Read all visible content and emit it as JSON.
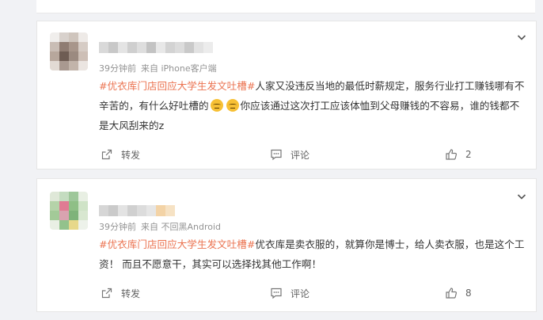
{
  "posts": [
    {
      "time": "39分钟前",
      "source": "来自 iPhone客户端",
      "topic": "#优衣库门店回应大学生发文吐槽#",
      "text_before_emoji": "人家又没违反当地的最低时薪规定，服务行业打工赚钱哪有不辛苦的，有什么好吐槽的",
      "text_after_emoji": "你应该通过这次打工应该体恤到父母赚钱的不容易，谁的钱都不是大风刮来的z",
      "forward_label": "转发",
      "comment_label": "评论",
      "like_count": "2"
    },
    {
      "time": "39分钟前",
      "source": "来自 不回黑Android",
      "topic": "#优衣库门店回应大学生发文吐槽#",
      "text": "优衣库是卖衣服的，就算你是博士，给人卖衣服，也是这个工资！ 而且不愿意干，其实可以选择找其他工作啊！",
      "forward_label": "转发",
      "comment_label": "评论",
      "like_count": "8"
    }
  ],
  "colors": {
    "topic": "#eb7350",
    "text": "#333333",
    "meta": "#939393",
    "action": "#636363",
    "background": "#f1f2f5"
  },
  "icons": [
    "chevron-down-icon",
    "forward-icon",
    "comment-icon",
    "thumbs-up-icon",
    "emoji-icon"
  ]
}
